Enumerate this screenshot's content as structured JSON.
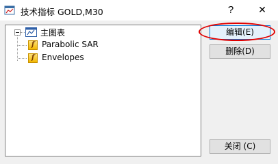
{
  "window": {
    "title": "技术指标 GOLD,M30",
    "help_label": "?",
    "close_label": "✕"
  },
  "tree": {
    "root": {
      "label": "主图表",
      "icon": "chart-window-icon"
    },
    "children": [
      {
        "label": "Parabolic SAR",
        "icon": "indicator-function-icon"
      },
      {
        "label": "Envelopes",
        "icon": "indicator-function-icon"
      }
    ]
  },
  "buttons": {
    "edit": "编辑(E)",
    "delete": "删除(D)",
    "close": "关闭 (C)"
  },
  "colors": {
    "highlight_ring": "#e00000",
    "default_button_border": "#0078d7"
  }
}
